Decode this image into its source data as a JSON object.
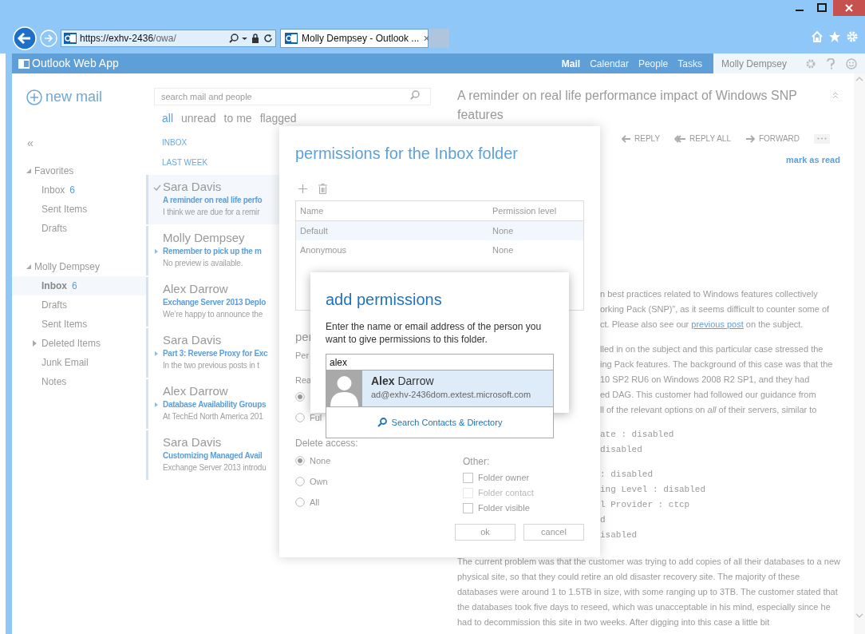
{
  "browser": {
    "url_main": "https://exhv-2436",
    "url_path": "/owa/",
    "tabs": [
      {
        "title": "Molly Dempsey - Outlook ...",
        "close": "×",
        "selected": true
      }
    ]
  },
  "app_header": {
    "title": "Outlook Web App",
    "nav": [
      {
        "label": "Mail",
        "selected": true
      },
      {
        "label": "Calendar",
        "selected": false
      },
      {
        "label": "People",
        "selected": false
      },
      {
        "label": "Tasks",
        "selected": false
      }
    ],
    "user": "Molly Dempsey"
  },
  "sidebar": {
    "new_mail": "new mail",
    "collapse": "«",
    "groups": [
      {
        "label": "Favorites",
        "expanded": true,
        "children": [
          {
            "label": "Inbox",
            "count": "6",
            "selected": false,
            "has_subfolders": false
          },
          {
            "label": "Sent Items",
            "selected": false,
            "has_subfolders": false
          },
          {
            "label": "Drafts",
            "selected": false,
            "has_subfolders": false
          }
        ]
      },
      {
        "label": "Molly Dempsey",
        "expanded": true,
        "children": [
          {
            "label": "Inbox",
            "count": "6",
            "selected": true,
            "has_subfolders": false
          },
          {
            "label": "Drafts",
            "selected": false,
            "has_subfolders": false
          },
          {
            "label": "Sent Items",
            "selected": false,
            "has_subfolders": false
          },
          {
            "label": "Deleted Items",
            "selected": false,
            "has_subfolders": true
          },
          {
            "label": "Junk Email",
            "selected": false,
            "has_subfolders": false
          },
          {
            "label": "Notes",
            "selected": false,
            "has_subfolders": false
          }
        ]
      }
    ]
  },
  "mail_list": {
    "search_placeholder": "search mail and people",
    "filters": [
      {
        "label": "all",
        "selected": true
      },
      {
        "label": "unread",
        "selected": false
      },
      {
        "label": "to me",
        "selected": false
      },
      {
        "label": "flagged",
        "selected": false
      }
    ],
    "folder_label": "INBOX",
    "group_label": "LAST WEEK",
    "items": [
      {
        "sender": "Sara Davis",
        "subject": "A reminder on real life perfo",
        "preview": "I think we are due for a remir",
        "selected": true,
        "conversation": false
      },
      {
        "sender": "Molly Dempsey",
        "subject": "Remember to pick up the m",
        "preview": "No preview is available.",
        "selected": false,
        "conversation": true
      },
      {
        "sender": "Alex Darrow",
        "subject": "Exchange Server 2013 Deplo",
        "preview": "We’re happy to announce the",
        "selected": false,
        "conversation": false
      },
      {
        "sender": "Sara Davis",
        "subject": "Part 3: Reverse Proxy for Exc",
        "preview": "In the two previous posts in t",
        "selected": false,
        "conversation": true
      },
      {
        "sender": "Alex Darrow",
        "subject": "Database Availability Groups",
        "preview": "At TechEd North America 201",
        "selected": false,
        "conversation": true
      },
      {
        "sender": "Sara Davis",
        "subject": "Customizing Managed Avail",
        "preview": "Exchange Server 2013 introdu",
        "selected": false,
        "conversation": false
      }
    ]
  },
  "reading_pane": {
    "subject": "A reminder on real life performance impact of Windows SNP features",
    "actions": [
      {
        "label": "REPLY",
        "kind": "reply"
      },
      {
        "label": "REPLY ALL",
        "kind": "reply_all"
      },
      {
        "label": "FORWARD",
        "kind": "forward"
      }
    ],
    "mark_as_read": "mark as read",
    "right_lines": [
      {
        "kind": "text",
        "text": "n best practices related to Windows features collectively"
      },
      {
        "kind": "text",
        "text": "orking Pack (SNP)”, as it seems difficult to counter some of"
      },
      {
        "kind": "link",
        "before": "ct. Please also see our ",
        "link": "previous post",
        "after": " on the subject."
      },
      {
        "kind": "gap"
      },
      {
        "kind": "text",
        "text": "lled in on the subject and this particular case stressed the"
      },
      {
        "kind": "text",
        "text": "ing Pack features. The background of this case was that the"
      },
      {
        "kind": "text",
        "text": "10 SP2 RU6 on Windows 2008 R2 SP1, and they had"
      },
      {
        "kind": "text",
        "text": "ed DAG. This customer had followed our guidance from"
      },
      {
        "kind": "text",
        "text": "ll of the relevant options on *all* of their servers, similar to"
      },
      {
        "kind": "gap"
      },
      {
        "kind": "code",
        "text": "ate : disabled"
      },
      {
        "kind": "code",
        "text": "disabled"
      },
      {
        "kind": "gap"
      },
      {
        "kind": "code",
        "text": ": disabled"
      },
      {
        "kind": "code",
        "text": "ing Level : disabled"
      },
      {
        "kind": "code",
        "text": "l Provider : ctcp"
      },
      {
        "kind": "code",
        "text": "d"
      },
      {
        "kind": "code",
        "text": "isabled"
      }
    ],
    "paragraph": "The current problem was that the customer was trying to add copies of all their databases to a new physical site, so that they could retire an old disaster recovery site. The majority of these databases were around 1 to 1.5TB in size, with some ranging up to 3TB. The customer stated that the databases took five days to reseed, which was unacceptable in his mind, especially since he had to decommission this site in two weeks. After digging into this case a little bit"
  },
  "permissions_dialog": {
    "title": "permissions for the Inbox folder",
    "columns": [
      "Name",
      "Permission level"
    ],
    "rows": [
      {
        "name": "Default",
        "level": "None",
        "selected": true
      },
      {
        "name": "Anonymous",
        "level": "None",
        "selected": false
      }
    ],
    "section_heading": "per",
    "section_label": "Per",
    "read_label": "Rea",
    "read_options": [
      {
        "checked": true
      },
      {
        "label": "Ful",
        "checked": false
      }
    ],
    "delete_label": "Delete access:",
    "delete_options": [
      {
        "label": "None",
        "checked": true
      },
      {
        "label": "Own",
        "checked": false
      },
      {
        "label": "All",
        "checked": false
      }
    ],
    "other_label": "Other:",
    "other_options": [
      {
        "label": "Folder owner",
        "checked": false,
        "disabled": false
      },
      {
        "label": "Folder contact",
        "checked": false,
        "disabled": true
      },
      {
        "label": "Folder visible",
        "checked": false,
        "disabled": false
      }
    ],
    "buttons": [
      "ok",
      "cancel"
    ]
  },
  "add_permissions": {
    "title": "add permissions",
    "instructions": "Enter the name or email address of the person you want to give permissions to this folder.",
    "value": "alex",
    "suggestions": [
      {
        "name": "**Alex** Darrow",
        "email": "ad@exhv-2436dom.extest.microsoft.com",
        "selected": true
      }
    ],
    "search_link": "Search Contacts & Directory"
  }
}
